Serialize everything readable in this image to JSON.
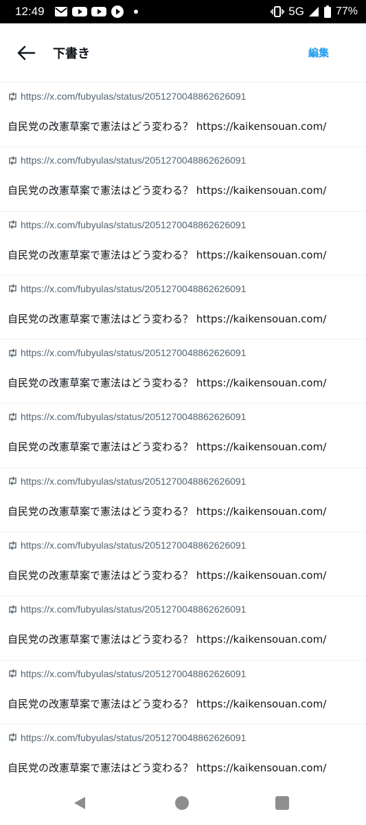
{
  "status_bar": {
    "time": "12:49",
    "network": "5G",
    "battery": "77%"
  },
  "header": {
    "title": "下書き",
    "edit_label": "編集"
  },
  "drafts": [
    {
      "quote_url": "https://x.com/fubyulas/status/2051270048862626091",
      "text": "自民党の改憲草案で憲法はどう変わる？ https://kaikensouan.com/"
    },
    {
      "quote_url": "https://x.com/fubyulas/status/2051270048862626091",
      "text": "自民党の改憲草案で憲法はどう変わる？ https://kaikensouan.com/"
    },
    {
      "quote_url": "https://x.com/fubyulas/status/2051270048862626091",
      "text": "自民党の改憲草案で憲法はどう変わる？ https://kaikensouan.com/"
    },
    {
      "quote_url": "https://x.com/fubyulas/status/2051270048862626091",
      "text": "自民党の改憲草案で憲法はどう変わる？ https://kaikensouan.com/"
    },
    {
      "quote_url": "https://x.com/fubyulas/status/2051270048862626091",
      "text": "自民党の改憲草案で憲法はどう変わる？ https://kaikensouan.com/"
    },
    {
      "quote_url": "https://x.com/fubyulas/status/2051270048862626091",
      "text": "自民党の改憲草案で憲法はどう変わる？ https://kaikensouan.com/"
    },
    {
      "quote_url": "https://x.com/fubyulas/status/2051270048862626091",
      "text": "自民党の改憲草案で憲法はどう変わる？ https://kaikensouan.com/"
    },
    {
      "quote_url": "https://x.com/fubyulas/status/2051270048862626091",
      "text": "自民党の改憲草案で憲法はどう変わる？ https://kaikensouan.com/"
    },
    {
      "quote_url": "https://x.com/fubyulas/status/2051270048862626091",
      "text": "自民党の改憲草案で憲法はどう変わる？ https://kaikensouan.com/"
    },
    {
      "quote_url": "https://x.com/fubyulas/status/2051270048862626091",
      "text": "自民党の改憲草案で憲法はどう変わる？ https://kaikensouan.com/"
    },
    {
      "quote_url": "https://x.com/fubyulas/status/2051270048862626091",
      "text": "自民党の改憲草案で憲法はどう変わる？ https://kaikensouan.com/"
    }
  ],
  "icons": {
    "status_left": [
      "gmail-icon",
      "youtube-icon",
      "youtube-icon",
      "play-icon"
    ],
    "status_right": [
      "vibrate-icon",
      "signal-icon",
      "battery-icon"
    ],
    "header_back": "arrow-left-icon",
    "repost": "repost-icon"
  },
  "colors": {
    "accent": "#1d9bf0",
    "secondary_text": "#536471",
    "primary_text": "#0f1419",
    "divider": "#eff3f4"
  }
}
